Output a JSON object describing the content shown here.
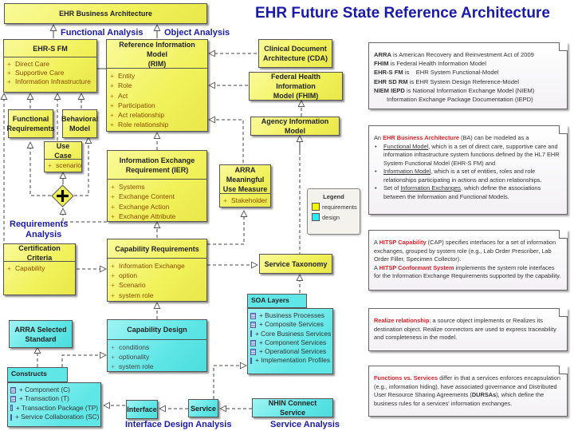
{
  "title": "EHR Future State Reference Architecture",
  "colors": {
    "requirements": "#f1f15a",
    "design": "#5fe6e6",
    "label_blue": "#1a1aa8",
    "highlight_red": "#e0202a"
  },
  "analysis_labels": {
    "functional": "Functional Analysis",
    "object": "Object Analysis",
    "requirements_line1": "Requirements",
    "requirements_line2": "Analysis",
    "interface_design": "Interface Design Analysis",
    "service": "Service Analysis"
  },
  "boxes": {
    "ehr_business_architecture": {
      "title": "EHR Business Architecture"
    },
    "ehr_s_fm": {
      "title": "EHR-S FM",
      "attributes": [
        "Direct Care",
        "Supportive Care",
        "Information Infrastructure"
      ]
    },
    "rim": {
      "title_line1": "Reference Information Model",
      "title_line2": "(RIM)",
      "attributes": [
        "Entity",
        "Role",
        "Act",
        "Participation",
        "Act relationship",
        "Role relationship"
      ]
    },
    "cda": {
      "title_line1": "Clinical Document",
      "title_line2": "Architecture (CDA)"
    },
    "fhim": {
      "title_line1": "Federal Health Information",
      "title_line2": "Model (FHIM)"
    },
    "agency_info_model": {
      "title": "Agency Information Model"
    },
    "functional_requirements": {
      "title_line1": "Functional",
      "title_line2": "Requirements"
    },
    "behavioral_model": {
      "title_line1": "Behavioral",
      "title_line2": "Model"
    },
    "use_case": {
      "title": "Use Case",
      "attributes": [
        "scenario"
      ]
    },
    "ier": {
      "title_line1": "Information Exchange",
      "title_line2": "Requirement (IER)",
      "attributes": [
        "Systems",
        "Exchange Content",
        "Exchange Action",
        "Exchange Attribute"
      ]
    },
    "arra_mu": {
      "title_line1": "ARRA Meaningful",
      "title_line2": "Use Measure",
      "attributes": [
        "Stakeholder"
      ]
    },
    "certification_criteria": {
      "title": "Certification Criteria",
      "attributes": [
        "Capability"
      ]
    },
    "capability_requirements": {
      "title": "Capability Requirements",
      "attributes": [
        "Information Exchange",
        "option",
        "Scenario",
        "system role"
      ]
    },
    "service_taxonomy": {
      "title": "Service Taxonomy"
    },
    "arra_selected_standard": {
      "title_line1": "ARRA Selected",
      "title_line2": "Standard"
    },
    "capability_design": {
      "title": "Capability Design",
      "attributes": [
        "conditions",
        "optionality",
        "system role"
      ]
    },
    "interface": {
      "title": "Interface"
    },
    "service": {
      "title": "Service"
    },
    "nhin_connect": {
      "title": "NHIN Connect Service"
    }
  },
  "packages": {
    "soa_layers": {
      "title": "SOA Layers",
      "items": [
        "+ Business Processes",
        "+ Composite Services",
        "+ Core Business Services",
        "+ Component Services",
        "+ Operational Services",
        "+ Implementation Profiles"
      ]
    },
    "constructs": {
      "title": "Constructs",
      "items": [
        "+ Component (C)",
        "+ Transaction (T)",
        "+ Transaction Package (TP)",
        "+ Service Collaboration (SC)"
      ]
    }
  },
  "legend": {
    "title": "Legend",
    "items": [
      {
        "label": "requirements",
        "color": "#f1f15a"
      },
      {
        "label": "design",
        "color": "#5fe6e6"
      }
    ]
  },
  "notes": {
    "acronyms": [
      {
        "term": "ARRA",
        "text": " is American Recovery and Reinvestment Act of 2009"
      },
      {
        "term": "FHIM",
        "text": " is Federal Health Information Model"
      },
      {
        "term": "EHR-S FM",
        "text": " is    EHR System Functional-Model"
      },
      {
        "term": "EHR SD RM",
        "text": " is EHR System Design Reference-Model"
      },
      {
        "term": "NIEM IEPD",
        "text": " is National Information Exchange Model (NIEM)"
      },
      {
        "term": "",
        "text": "Information Exchange Package Documentation (IEPD)"
      }
    ],
    "business_architecture": {
      "intro_pre": "An ",
      "intro_highlight": "EHR Business Architecture",
      "intro_post": " (BA) can be modeled as a",
      "bullets": [
        {
          "term": "Functional Model",
          "text": ", which is a set of direct care, supportive care and information infrastructure system functions defined by  the HL7 EHR System Functional Model  (EHR-S FM) and"
        },
        {
          "term": "Information Model",
          "text": ", which is a set of entities, roles and role relationships participating in actions  and action relationships."
        },
        {
          "pre": "Set of ",
          "term": "Information Exchanges",
          "text": ", which define the associations between the Information and Functional Models."
        }
      ]
    },
    "hitsp": {
      "p1_pre": "A ",
      "p1_highlight": "HITSP Capability",
      "p1_post": " (CAP) specifies interfaces for a set of information exchanges, grouped by system role (e.g., Lab Order Prescriber, Lab Order Filler, Specimen Collector).",
      "p2_pre": "A ",
      "p2_highlight": "HITSP Conformant System",
      "p2_post": " implements the system role interfaces for the Information Exchange Requirements supported by the capability."
    },
    "realize": {
      "highlight": "Realize relationship",
      "text": ": a source object implements or Realizes its destination object. Realize connectors are used to express traceability and completeness in the model."
    },
    "functions_vs_services": {
      "highlight": "Functions vs. Services",
      "text1": " differ in that a services enforces encapsulation (e.g., information hiding), have associated governance and Distributed User Resource Sharing  Agreements (",
      "bold": "DURSAs",
      "text2": "), which define the business rules for a services' information exchanges."
    }
  }
}
